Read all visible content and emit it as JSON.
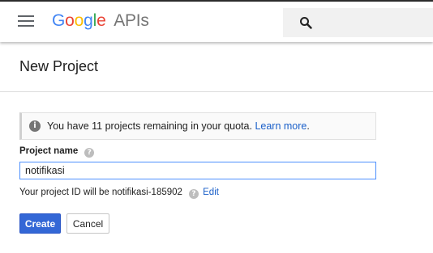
{
  "header": {
    "logo_letters": [
      {
        "char": "G",
        "color": "#4285F4"
      },
      {
        "char": "o",
        "color": "#EA4335"
      },
      {
        "char": "o",
        "color": "#FBBC05"
      },
      {
        "char": "g",
        "color": "#4285F4"
      },
      {
        "char": "l",
        "color": "#34A853"
      },
      {
        "char": "e",
        "color": "#EA4335"
      }
    ],
    "product": "APIs",
    "menu_icon": "hamburger-menu-icon",
    "search_icon": "search-icon"
  },
  "page": {
    "title": "New Project"
  },
  "quota_notice": {
    "text": "You have 11 projects remaining in your quota.",
    "link": "Learn more",
    "suffix": "."
  },
  "form": {
    "name_label": "Project name",
    "name_value": "notifikasi",
    "project_id_text": "Your project ID will be notifikasi-185902",
    "edit_label": "Edit"
  },
  "actions": {
    "create_label": "Create",
    "cancel_label": "Cancel"
  },
  "colors": {
    "accent": "#3367d6",
    "link": "#1a5fc9"
  }
}
